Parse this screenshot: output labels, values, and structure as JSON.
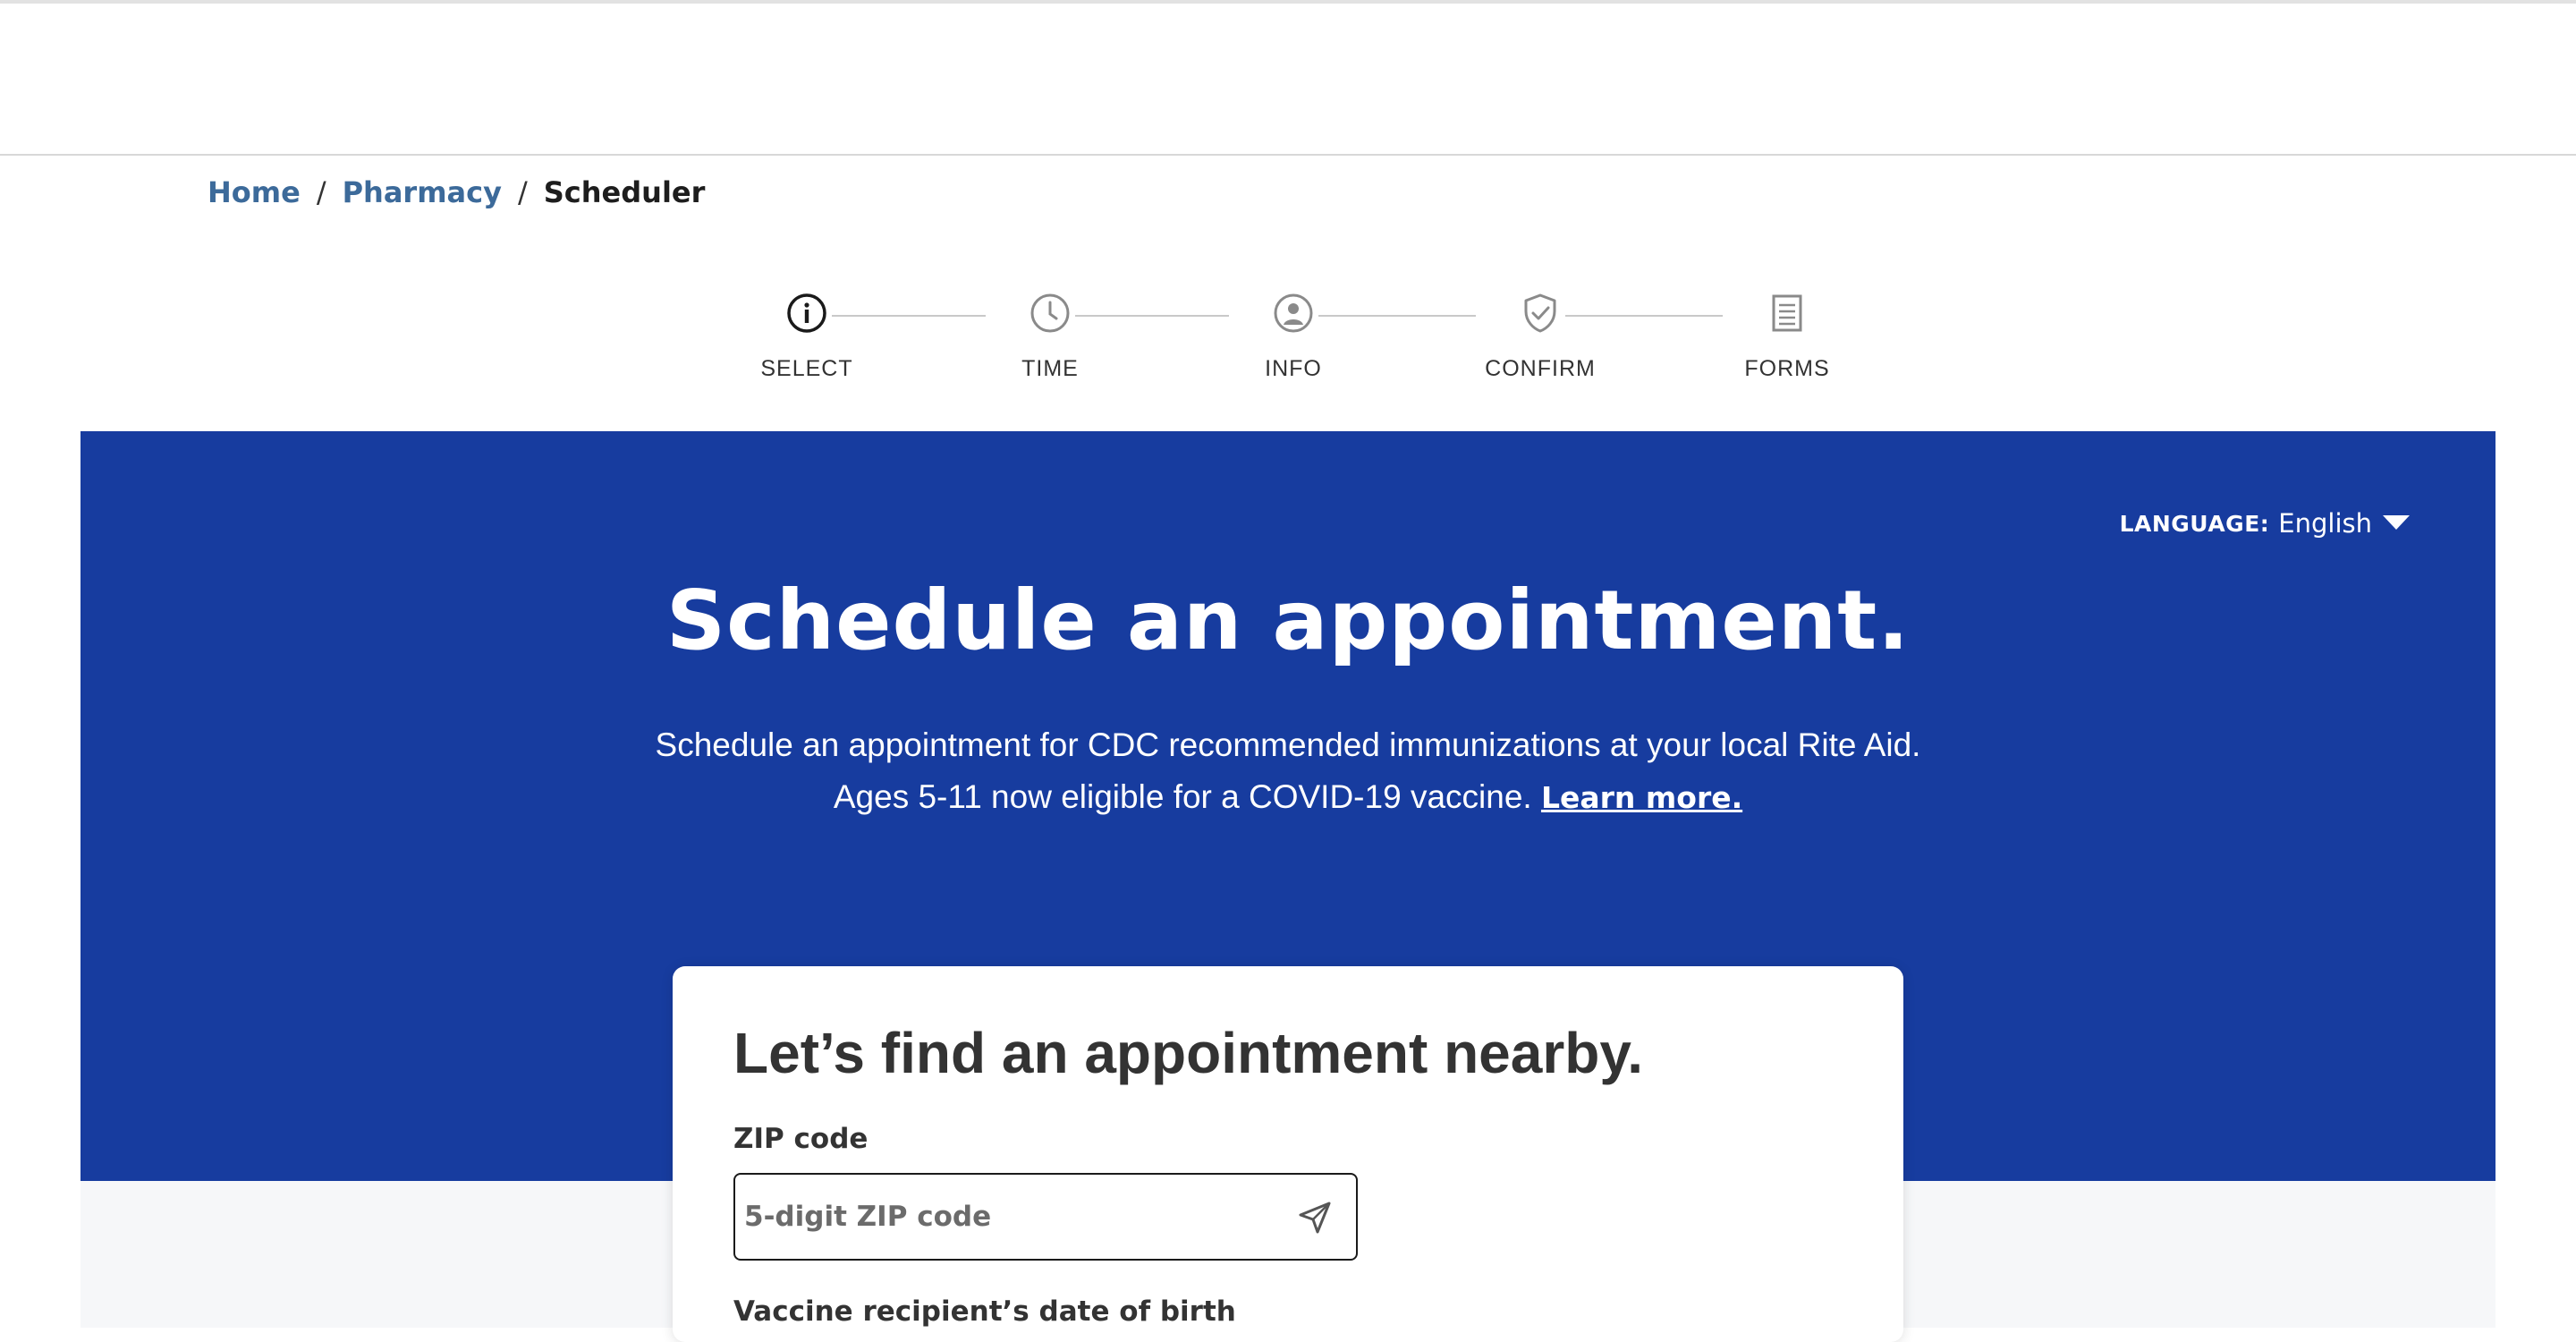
{
  "breadcrumb": {
    "home": "Home",
    "pharmacy": "Pharmacy",
    "current": "Scheduler"
  },
  "stepper": {
    "steps": [
      {
        "label": "SELECT",
        "icon": "info-icon",
        "active": true
      },
      {
        "label": "TIME",
        "icon": "clock-icon",
        "active": false
      },
      {
        "label": "INFO",
        "icon": "user-icon",
        "active": false
      },
      {
        "label": "CONFIRM",
        "icon": "shield-check-icon",
        "active": false
      },
      {
        "label": "FORMS",
        "icon": "document-icon",
        "active": false
      }
    ]
  },
  "language": {
    "key": "LANGUAGE:",
    "value": "English"
  },
  "hero": {
    "title": "Schedule an appointment.",
    "subtitle_line1": "Schedule an appointment for CDC recommended immunizations at your local Rite Aid.",
    "subtitle_line2": "Ages 5-11 now eligible for a COVID-19 vaccine.",
    "learn_more": "Learn more."
  },
  "card": {
    "title": "Let’s find an appointment nearby.",
    "zip_label": "ZIP code",
    "zip_placeholder": "5-digit ZIP code",
    "zip_value": "",
    "dob_label": "Vaccine recipient’s date of birth"
  },
  "colors": {
    "hero_bg": "#173c9f",
    "link": "#3c6a9a",
    "text_dark": "#333333"
  }
}
